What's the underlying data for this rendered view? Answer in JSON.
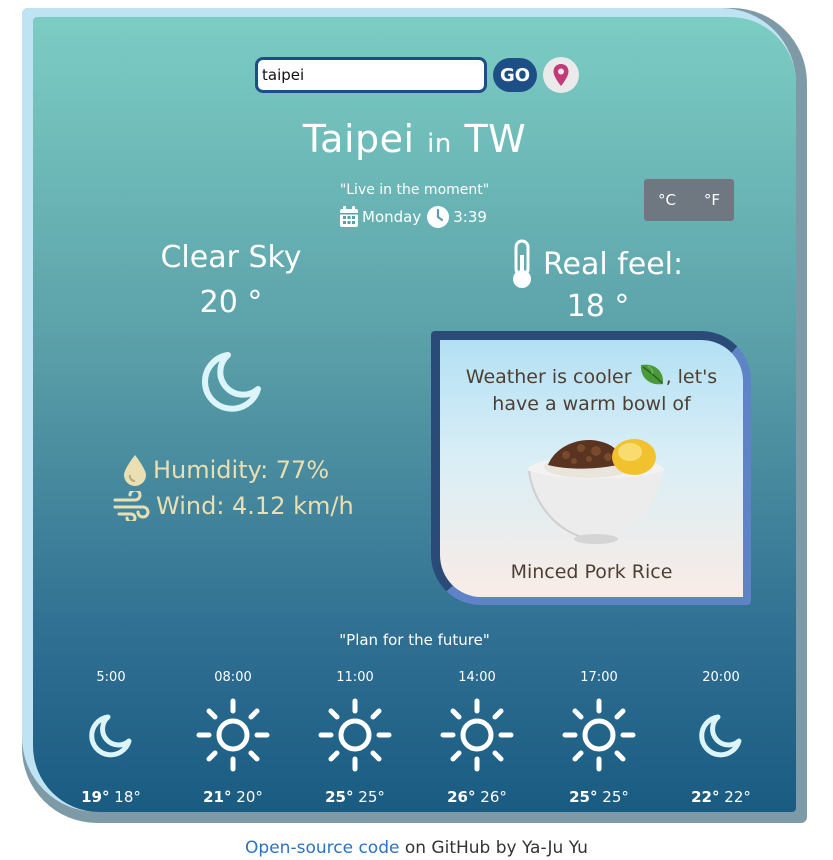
{
  "search": {
    "value": "taipei",
    "go_label": "GO",
    "location_icon": "map-pin-icon"
  },
  "header": {
    "city": "Taipei",
    "connector": "in",
    "country": "TW"
  },
  "quote": "\"Live in the moment\"",
  "datetime": {
    "day": "Monday",
    "time": "3:39",
    "calendar_icon": "calendar-icon",
    "clock_icon": "clock-icon"
  },
  "units": {
    "celsius": "°C",
    "fahrenheit": "°F"
  },
  "current": {
    "description": "Clear Sky",
    "temperature": "20 °",
    "icon": "moon-icon",
    "humidity": "Humidity: 77%",
    "wind": "Wind: 4.12 km/h"
  },
  "real_feel": {
    "label": "Real feel:",
    "temperature": "18 °"
  },
  "food": {
    "message_before": "Weather is cooler",
    "message_after": ", let's have a warm bowl of",
    "name": "Minced Pork Rice",
    "leaf_icon": "leaf-icon",
    "dish_icon": "rice-bowl-icon"
  },
  "plan": "\"Plan for the future\"",
  "forecast": [
    {
      "time": "5:00",
      "high": "19°",
      "low": "18°",
      "icon": "moon"
    },
    {
      "time": "08:00",
      "high": "21°",
      "low": "20°",
      "icon": "sun"
    },
    {
      "time": "11:00",
      "high": "25°",
      "low": "25°",
      "icon": "sun"
    },
    {
      "time": "14:00",
      "high": "26°",
      "low": "26°",
      "icon": "sun"
    },
    {
      "time": "17:00",
      "high": "25°",
      "low": "25°",
      "icon": "sun"
    },
    {
      "time": "20:00",
      "high": "22°",
      "low": "22°",
      "icon": "moon"
    }
  ],
  "footer": {
    "link": "Open-source code",
    "rest": " on GitHub by Ya-Ju Yu"
  },
  "colors": {
    "card_top": "#7ccdc4",
    "card_bottom": "#1a5b82",
    "accent": "#1d4f86",
    "humidity_text": "#e9dfb2"
  }
}
